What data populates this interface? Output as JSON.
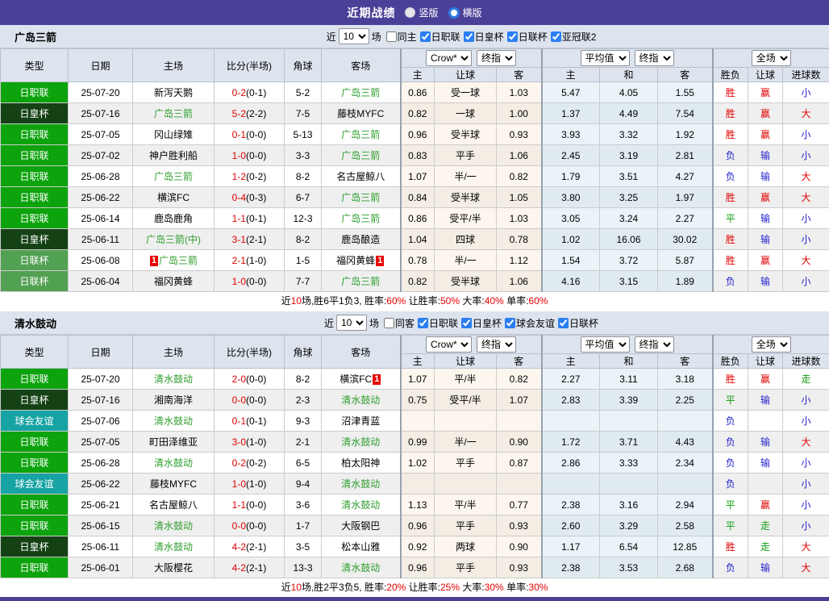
{
  "topbar": {
    "title": "近期战绩",
    "radios": [
      {
        "label": "竖版",
        "selected": true
      },
      {
        "label": "横版",
        "selected": false
      }
    ]
  },
  "header": {
    "cols": [
      "类型",
      "日期",
      "主场",
      "比分(半场)",
      "角球",
      "客场"
    ],
    "selects": [
      "Crow*",
      "终指",
      "平均值",
      "终指",
      "全场"
    ],
    "sub": [
      "主",
      "让球",
      "客",
      "主",
      "和",
      "客",
      "胜负",
      "让球",
      "进球数"
    ]
  },
  "legend_colors": {
    "日职联": "#0ca30c",
    "日皇杯": "#154215",
    "日联杯": "#52a052",
    "球会友谊": "#17a3a3"
  },
  "result_colors": {
    "胜": "#e00000",
    "赢": "#e00000",
    "大": "#e00000",
    "负": "#2323cc",
    "输": "#2323cc",
    "小": "#2323cc",
    "平": "#0f9d0f",
    "走": "#0f9d0f"
  },
  "sections": [
    {
      "team": "广岛三箭",
      "filter": {
        "near": "近",
        "count": "10",
        "unit": "场",
        "same": "同主",
        "leagues": [
          "日职联",
          "日皇杯",
          "日联杯",
          "亚冠联2"
        ]
      },
      "rows": [
        {
          "type": "日职联",
          "date": "25-07-20",
          "home": "新泻天鹅",
          "home_hl": false,
          "score": "0-2",
          "half": "(0-1)",
          "corner": "5-2",
          "away": "广岛三箭",
          "away_hl": true,
          "odds": [
            "0.86",
            "受一球",
            "1.03"
          ],
          "avg": [
            "5.47",
            "4.05",
            "1.55"
          ],
          "res": [
            "胜",
            "赢",
            "小"
          ]
        },
        {
          "type": "日皇杯",
          "date": "25-07-16",
          "home": "广岛三箭",
          "home_hl": true,
          "score": "5-2",
          "half": "(2-2)",
          "corner": "7-5",
          "away": "藤枝MYFC",
          "away_hl": false,
          "odds": [
            "0.82",
            "一球",
            "1.00"
          ],
          "avg": [
            "1.37",
            "4.49",
            "7.54"
          ],
          "res": [
            "胜",
            "赢",
            "大"
          ]
        },
        {
          "type": "日职联",
          "date": "25-07-05",
          "home": "冈山绿雉",
          "home_hl": false,
          "score": "0-1",
          "half": "(0-0)",
          "corner": "5-13",
          "away": "广岛三箭",
          "away_hl": true,
          "odds": [
            "0.96",
            "受半球",
            "0.93"
          ],
          "avg": [
            "3.93",
            "3.32",
            "1.92"
          ],
          "res": [
            "胜",
            "赢",
            "小"
          ]
        },
        {
          "type": "日职联",
          "date": "25-07-02",
          "home": "神户胜利船",
          "home_hl": false,
          "score": "1-0",
          "half": "(0-0)",
          "corner": "3-3",
          "away": "广岛三箭",
          "away_hl": true,
          "odds": [
            "0.83",
            "平手",
            "1.06"
          ],
          "avg": [
            "2.45",
            "3.19",
            "2.81"
          ],
          "res": [
            "负",
            "输",
            "小"
          ]
        },
        {
          "type": "日职联",
          "date": "25-06-28",
          "home": "广岛三箭",
          "home_hl": true,
          "score": "1-2",
          "half": "(0-2)",
          "corner": "8-2",
          "away": "名古屋鲸八",
          "away_hl": false,
          "odds": [
            "1.07",
            "半/一",
            "0.82"
          ],
          "avg": [
            "1.79",
            "3.51",
            "4.27"
          ],
          "res": [
            "负",
            "输",
            "大"
          ]
        },
        {
          "type": "日职联",
          "date": "25-06-22",
          "home": "横滨FC",
          "home_hl": false,
          "score": "0-4",
          "half": "(0-3)",
          "corner": "6-7",
          "away": "广岛三箭",
          "away_hl": true,
          "odds": [
            "0.84",
            "受半球",
            "1.05"
          ],
          "avg": [
            "3.80",
            "3.25",
            "1.97"
          ],
          "res": [
            "胜",
            "赢",
            "大"
          ]
        },
        {
          "type": "日职联",
          "date": "25-06-14",
          "home": "鹿岛鹿角",
          "home_hl": false,
          "score": "1-1",
          "half": "(0-1)",
          "corner": "12-3",
          "away": "广岛三箭",
          "away_hl": true,
          "odds": [
            "0.86",
            "受平/半",
            "1.03"
          ],
          "avg": [
            "3.05",
            "3.24",
            "2.27"
          ],
          "res": [
            "平",
            "输",
            "小"
          ]
        },
        {
          "type": "日皇杯",
          "date": "25-06-11",
          "home": "广岛三箭(中)",
          "home_hl": true,
          "score": "3-1",
          "half": "(2-1)",
          "corner": "8-2",
          "away": "鹿岛酿造",
          "away_hl": false,
          "odds": [
            "1.04",
            "四球",
            "0.78"
          ],
          "avg": [
            "1.02",
            "16.06",
            "30.02"
          ],
          "res": [
            "胜",
            "输",
            "小"
          ]
        },
        {
          "type": "日联杯",
          "date": "25-06-08",
          "home": "广岛三箭",
          "home_hl": true,
          "home_badge": "1",
          "score": "2-1",
          "half": "(1-0)",
          "corner": "1-5",
          "away": "福冈黄蜂",
          "away_hl": false,
          "away_badge": "1",
          "odds": [
            "0.78",
            "半/一",
            "1.12"
          ],
          "avg": [
            "1.54",
            "3.72",
            "5.87"
          ],
          "res": [
            "胜",
            "赢",
            "大"
          ]
        },
        {
          "type": "日联杯",
          "date": "25-06-04",
          "home": "福冈黄蜂",
          "home_hl": false,
          "score": "1-0",
          "half": "(0-0)",
          "corner": "7-7",
          "away": "广岛三箭",
          "away_hl": true,
          "odds": [
            "0.82",
            "受半球",
            "1.06"
          ],
          "avg": [
            "4.16",
            "3.15",
            "1.89"
          ],
          "res": [
            "负",
            "输",
            "小"
          ]
        }
      ],
      "summary": [
        [
          "近",
          0
        ],
        [
          "10",
          1
        ],
        [
          "场,胜6平1负3, 胜率:",
          0
        ],
        [
          "60%",
          1
        ],
        [
          " 让胜率:",
          0
        ],
        [
          "50%",
          1
        ],
        [
          " 大率:",
          0
        ],
        [
          "40%",
          1
        ],
        [
          " 单率:",
          0
        ],
        [
          "60%",
          1
        ]
      ]
    },
    {
      "team": "清水鼓动",
      "filter": {
        "near": "近",
        "count": "10",
        "unit": "场",
        "same": "同客",
        "leagues": [
          "日职联",
          "日皇杯",
          "球会友谊",
          "日联杯"
        ]
      },
      "rows": [
        {
          "type": "日职联",
          "date": "25-07-20",
          "home": "清水鼓动",
          "home_hl": true,
          "score": "2-0",
          "half": "(0-0)",
          "corner": "8-2",
          "away": "横滨FC",
          "away_hl": false,
          "away_badge": "1",
          "odds": [
            "1.07",
            "平/半",
            "0.82"
          ],
          "avg": [
            "2.27",
            "3.11",
            "3.18"
          ],
          "res": [
            "胜",
            "赢",
            "走"
          ]
        },
        {
          "type": "日皇杯",
          "date": "25-07-16",
          "home": "湘南海洋",
          "home_hl": false,
          "score": "0-0",
          "half": "(0-0)",
          "corner": "2-3",
          "away": "清水鼓动",
          "away_hl": true,
          "odds": [
            "0.75",
            "受平/半",
            "1.07"
          ],
          "avg": [
            "2.83",
            "3.39",
            "2.25"
          ],
          "res": [
            "平",
            "输",
            "小"
          ]
        },
        {
          "type": "球会友谊",
          "date": "25-07-06",
          "home": "清水鼓动",
          "home_hl": true,
          "score": "0-1",
          "half": "(0-1)",
          "corner": "9-3",
          "away": "沼津青蓝",
          "away_hl": false,
          "odds": [
            "",
            "",
            ""
          ],
          "avg": [
            "",
            "",
            ""
          ],
          "res": [
            "负",
            "",
            "小"
          ]
        },
        {
          "type": "日职联",
          "date": "25-07-05",
          "home": "町田泽维亚",
          "home_hl": false,
          "score": "3-0",
          "half": "(1-0)",
          "corner": "2-1",
          "away": "清水鼓动",
          "away_hl": true,
          "odds": [
            "0.99",
            "半/一",
            "0.90"
          ],
          "avg": [
            "1.72",
            "3.71",
            "4.43"
          ],
          "res": [
            "负",
            "输",
            "大"
          ]
        },
        {
          "type": "日职联",
          "date": "25-06-28",
          "home": "清水鼓动",
          "home_hl": true,
          "score": "0-2",
          "half": "(0-2)",
          "corner": "6-5",
          "away": "柏太阳神",
          "away_hl": false,
          "odds": [
            "1.02",
            "平手",
            "0.87"
          ],
          "avg": [
            "2.86",
            "3.33",
            "2.34"
          ],
          "res": [
            "负",
            "输",
            "小"
          ]
        },
        {
          "type": "球会友谊",
          "date": "25-06-22",
          "home": "藤枝MYFC",
          "home_hl": false,
          "score": "1-0",
          "half": "(1-0)",
          "corner": "9-4",
          "away": "清水鼓动",
          "away_hl": true,
          "odds": [
            "",
            "",
            ""
          ],
          "avg": [
            "",
            "",
            ""
          ],
          "res": [
            "负",
            "",
            "小"
          ]
        },
        {
          "type": "日职联",
          "date": "25-06-21",
          "home": "名古屋鲸八",
          "home_hl": false,
          "score": "1-1",
          "half": "(0-0)",
          "corner": "3-6",
          "away": "清水鼓动",
          "away_hl": true,
          "odds": [
            "1.13",
            "平/半",
            "0.77"
          ],
          "avg": [
            "2.38",
            "3.16",
            "2.94"
          ],
          "res": [
            "平",
            "赢",
            "小"
          ]
        },
        {
          "type": "日职联",
          "date": "25-06-15",
          "home": "清水鼓动",
          "home_hl": true,
          "score": "0-0",
          "half": "(0-0)",
          "corner": "1-7",
          "away": "大阪钢巴",
          "away_hl": false,
          "odds": [
            "0.96",
            "平手",
            "0.93"
          ],
          "avg": [
            "2.60",
            "3.29",
            "2.58"
          ],
          "res": [
            "平",
            "走",
            "小"
          ]
        },
        {
          "type": "日皇杯",
          "date": "25-06-11",
          "home": "清水鼓动",
          "home_hl": true,
          "score": "4-2",
          "half": "(2-1)",
          "corner": "3-5",
          "away": "松本山雅",
          "away_hl": false,
          "odds": [
            "0.92",
            "两球",
            "0.90"
          ],
          "avg": [
            "1.17",
            "6.54",
            "12.85"
          ],
          "res": [
            "胜",
            "走",
            "大"
          ]
        },
        {
          "type": "日职联",
          "date": "25-06-01",
          "home": "大阪樱花",
          "home_hl": false,
          "score": "4-2",
          "half": "(2-1)",
          "corner": "13-3",
          "away": "清水鼓动",
          "away_hl": true,
          "odds": [
            "0.96",
            "平手",
            "0.93"
          ],
          "avg": [
            "2.38",
            "3.53",
            "2.68"
          ],
          "res": [
            "负",
            "输",
            "大"
          ]
        }
      ],
      "summary": [
        [
          "近",
          0
        ],
        [
          "10",
          1
        ],
        [
          "场,胜2平3负5, 胜率:",
          0
        ],
        [
          "20%",
          1
        ],
        [
          " 让胜率:",
          0
        ],
        [
          "25%",
          1
        ],
        [
          " 大率:",
          0
        ],
        [
          "30%",
          1
        ],
        [
          " 单率:",
          0
        ],
        [
          "30%",
          1
        ]
      ]
    }
  ]
}
